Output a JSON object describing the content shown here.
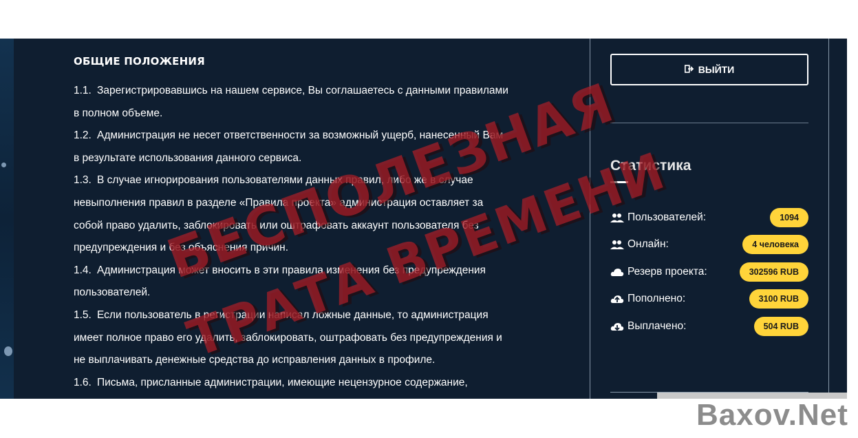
{
  "content": {
    "section_title": "ОБЩИЕ ПОЛОЖЕНИЯ",
    "lines": [
      {
        "num": "1.1.",
        "text": "Зарегистрировавшись на нашем сервисе, Вы соглашаетесь с данными правилами"
      },
      {
        "num": "",
        "text": "в полном объеме."
      },
      {
        "num": "1.2.",
        "text": "Администрация не несет ответственности за возможный ущерб, нанесенный Вам"
      },
      {
        "num": "",
        "text": "в результате использования данного сервиса."
      },
      {
        "num": "1.3.",
        "text": "В случае игнорирования пользователями данных правил, либо же в случае"
      },
      {
        "num": "",
        "text": "невыполнения правил в разделе «Правила проекта» администрация оставляет за"
      },
      {
        "num": "",
        "text": "собой право удалить, заблокировать или оштрафовать аккаунт пользователя без"
      },
      {
        "num": "",
        "text": "предупреждения и без объяснения причин."
      },
      {
        "num": "1.4.",
        "text": "Администрация может вносить в эти правила изменения без предупреждения"
      },
      {
        "num": "",
        "text": "пользователей."
      },
      {
        "num": "1.5.",
        "text": "Если пользователь в регистрации написал ложные данные, то администрация"
      },
      {
        "num": "",
        "text": "имеет полное право его удалить, заблокировать, оштрафовать без предупреждения и"
      },
      {
        "num": "",
        "text": "не выплачивать денежные средства до исправления данных в профиле."
      },
      {
        "num": "1.6.",
        "text": "Письма, присланные администрации, имеющие нецензурное содержание,"
      }
    ]
  },
  "sidebar": {
    "logout_label": "ВЫЙТИ",
    "stats_title": "Статистика",
    "stats": [
      {
        "label": "Пользователей:",
        "value": "1094",
        "icon": "users-icon"
      },
      {
        "label": "Онлайн:",
        "value": "4 человека",
        "icon": "users-icon"
      },
      {
        "label": "Резерв проекта:",
        "value": "302596 RUB",
        "icon": "cloud-icon"
      },
      {
        "label": "Пополнено:",
        "value": "3100 RUB",
        "icon": "cloud-upload-icon"
      },
      {
        "label": "Выплачено:",
        "value": "504 RUB",
        "icon": "cloud-download-icon"
      }
    ]
  },
  "stamp": {
    "line1": "БЕСПОЛЕЗНАЯ",
    "line2": "ТРАТА ВРЕМЕНИ"
  },
  "watermark": "Baxov.Net",
  "colors": {
    "background": "#0f1e30",
    "badge": "#ffd43a",
    "stamp": "#aa1e28"
  }
}
